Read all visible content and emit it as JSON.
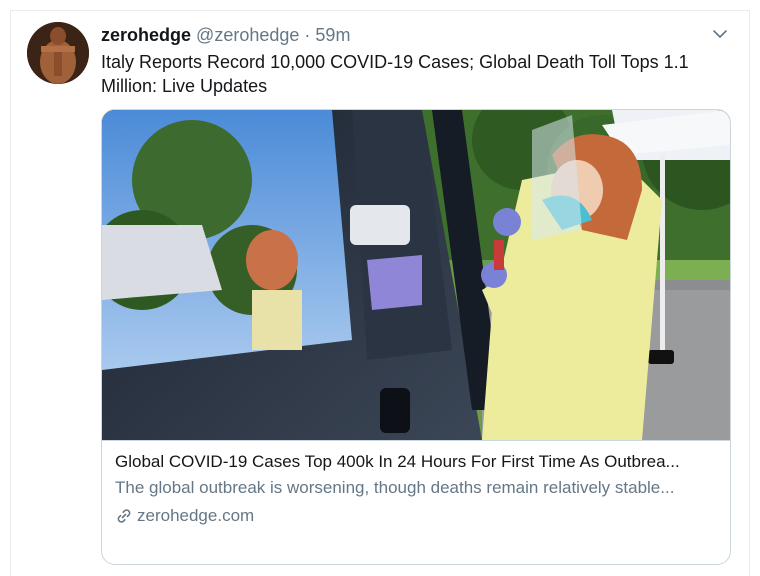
{
  "tweet": {
    "author_name": "zerohedge",
    "author_handle": "@zerohedge",
    "separator": "·",
    "time": "59m",
    "text": "Italy Reports Record 10,000 COVID-19 Cases; Global Death Toll Tops 1.1 Million: Live Updates",
    "caret_icon": "chevron-down-icon",
    "avatar_icon": "avatar"
  },
  "card": {
    "image_icon": "covid-test-drive-through-photo",
    "title": "Global COVID-19 Cases Top 400k In 24 Hours For First Time As Outbrea...",
    "description": "The global outbreak is worsening, though deaths remain relatively stable...",
    "link_icon": "link-icon",
    "domain": "zerohedge.com"
  },
  "colors": {
    "text_primary": "#14171a",
    "text_secondary": "#657786",
    "border": "#ccd6dd"
  }
}
